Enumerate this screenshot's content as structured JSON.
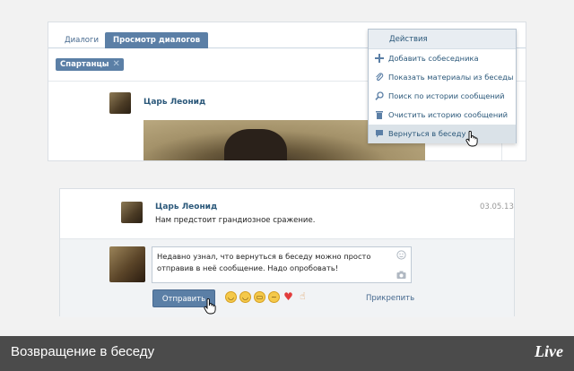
{
  "top": {
    "tabs": [
      "Диалоги",
      "Просмотр диалогов"
    ],
    "chip": {
      "label": "Спартанцы",
      "close": "✕"
    },
    "message": {
      "author": "Царь Леонид"
    }
  },
  "menu": {
    "header": "Действия",
    "items": [
      {
        "label": "Добавить собеседника",
        "icon": "plus-icon"
      },
      {
        "label": "Показать материалы из беседы",
        "icon": "paperclip-icon"
      },
      {
        "label": "Поиск по истории сообщений",
        "icon": "search-icon"
      },
      {
        "label": "Очистить историю сообщений",
        "icon": "trash-icon"
      },
      {
        "label": "Вернуться в беседу",
        "icon": "chat-bubble-icon"
      }
    ]
  },
  "bottom": {
    "message": {
      "author": "Царь Леонид",
      "text": "Нам предстоит грандиозное сражение.",
      "date": "03.05.13"
    },
    "compose": {
      "line1": "Недавно узнал, что вернуться в беседу можно просто",
      "line2": "отправив в неё сообщение. Надо опробовать!",
      "send_label": "Отправить",
      "attach_label": "Прикрепить"
    }
  },
  "footer": {
    "title": "Возвращение в беседу",
    "logo": "Live"
  },
  "colors": {
    "accent": "#5b7fa6",
    "link": "#2b587a",
    "footer_bg": "#4b4b4b"
  }
}
